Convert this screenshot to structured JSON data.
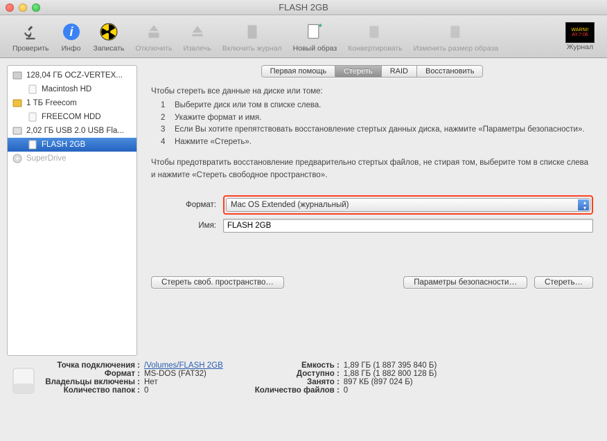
{
  "window": {
    "title": "FLASH 2GB"
  },
  "toolbar": {
    "items": [
      {
        "id": "verify",
        "label": "Проверить"
      },
      {
        "id": "info",
        "label": "Инфо"
      },
      {
        "id": "burn",
        "label": "Записать"
      },
      {
        "id": "unmount",
        "label": "Отключить"
      },
      {
        "id": "eject",
        "label": "Извлечь"
      },
      {
        "id": "journal",
        "label": "Включить журнал"
      },
      {
        "id": "newimage",
        "label": "Новый образ"
      },
      {
        "id": "convert",
        "label": "Конвертировать"
      },
      {
        "id": "resize",
        "label": "Изменить размер образа"
      }
    ],
    "right": {
      "label": "Журнал"
    }
  },
  "sidebar": {
    "items": [
      {
        "label": "128,04 ГБ OCZ-VERTEX...",
        "level": 0,
        "type": "disk"
      },
      {
        "label": "Macintosh HD",
        "level": 1,
        "type": "vol"
      },
      {
        "label": "1 ТБ Freecom",
        "level": 0,
        "type": "ext"
      },
      {
        "label": "FREECOM HDD",
        "level": 1,
        "type": "vol"
      },
      {
        "label": "2,02 ГБ USB 2.0 USB Fla...",
        "level": 0,
        "type": "usb"
      },
      {
        "label": "FLASH 2GB",
        "level": 1,
        "type": "vol",
        "selected": true
      },
      {
        "label": "SuperDrive",
        "level": 0,
        "type": "optical",
        "dim": true
      }
    ]
  },
  "tabs": {
    "items": [
      {
        "label": "Первая помощь"
      },
      {
        "label": "Стереть",
        "active": true
      },
      {
        "label": "RAID"
      },
      {
        "label": "Восстановить"
      }
    ]
  },
  "instructions": {
    "header": "Чтобы стереть все данные на диске или томе:",
    "steps": [
      "Выберите диск или том в списке слева.",
      "Укажите формат и имя.",
      "Если Вы хотите препятствовать восстановление стертых данных диска, нажмите «Параметры безопасности».",
      "Нажмите «Стереть»."
    ],
    "note": "Чтобы предотвратить восстановление предварительно стертых файлов, не стирая том, выберите том в списке слева и нажмите «Стереть свободное пространство»."
  },
  "form": {
    "format_label": "Формат:",
    "format_value": "Mac OS Extended (журнальный)",
    "name_label": "Имя:",
    "name_value": "FLASH 2GB"
  },
  "buttons": {
    "erase_free": "Стереть своб. пространство…",
    "security": "Параметры безопасности…",
    "erase": "Стереть…"
  },
  "footer": {
    "left": {
      "mount_point_k": "Точка подключения :",
      "mount_point_v": "/Volumes/FLASH 2GB",
      "format_k": "Формат :",
      "format_v": "MS-DOS (FAT32)",
      "owners_k": "Владельцы включены :",
      "owners_v": "Нет",
      "folders_k": "Количество папок :",
      "folders_v": "0"
    },
    "right": {
      "capacity_k": "Емкость :",
      "capacity_v": "1,89 ГБ (1 887 395 840 Б)",
      "avail_k": "Доступно :",
      "avail_v": "1,88 ГБ (1 882 800 128 Б)",
      "used_k": "Занято :",
      "used_v": "897 КБ (897 024 Б)",
      "files_k": "Количество файлов :",
      "files_v": "0"
    }
  }
}
